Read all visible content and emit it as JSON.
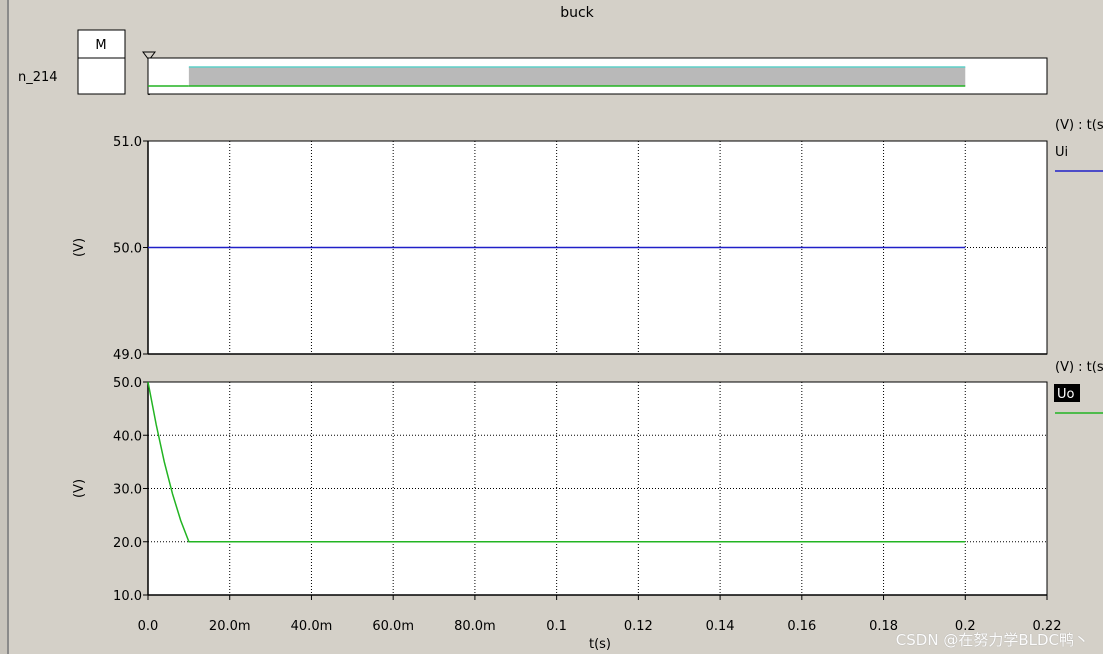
{
  "title": "buck",
  "digital": {
    "name": "n_214",
    "mode": "M"
  },
  "colors": {
    "ui": "#2020c8",
    "uo": "#22b422",
    "digital_fill": "#b9b9b9",
    "digital_edge": "#5ed0c8",
    "digital_line": "#22b422"
  },
  "watermark": "CSDN @在努力学BLDC鸭丶",
  "chart_data": [
    {
      "type": "line",
      "ylabel": "(V)",
      "legend_unit": "(V) : t(s)",
      "ylim": [
        49.0,
        51.0
      ],
      "yticks": [
        "51.0",
        "50.0",
        "49.0"
      ],
      "ytick_values": [
        51.0,
        50.0,
        49.0
      ],
      "xlim": [
        0,
        0.22
      ],
      "grid": true,
      "series": [
        {
          "name": "Ui",
          "x": [
            0,
            0.2
          ],
          "y": [
            50.0,
            50.0
          ]
        }
      ]
    },
    {
      "type": "line",
      "ylabel": "(V)",
      "legend_unit": "(V) : t(s)",
      "xlabel": "t(s)",
      "ylim": [
        10.0,
        50.0
      ],
      "yticks": [
        "50.0",
        "40.0",
        "30.0",
        "20.0",
        "10.0"
      ],
      "ytick_values": [
        50.0,
        40.0,
        30.0,
        20.0,
        10.0
      ],
      "xlim": [
        0,
        0.22
      ],
      "xticks": [
        "0.0",
        "20.0m",
        "40.0m",
        "60.0m",
        "80.0m",
        "0.1",
        "0.12",
        "0.14",
        "0.16",
        "0.18",
        "0.2",
        "0.22"
      ],
      "xtick_values": [
        0,
        0.02,
        0.04,
        0.06,
        0.08,
        0.1,
        0.12,
        0.14,
        0.16,
        0.18,
        0.2,
        0.22
      ],
      "grid": true,
      "series": [
        {
          "name": "Uo",
          "x": [
            0,
            0.002,
            0.004,
            0.006,
            0.008,
            0.01,
            0.2
          ],
          "y": [
            50.0,
            42.0,
            35.0,
            29.0,
            24.0,
            20.0,
            20.0
          ]
        }
      ]
    }
  ]
}
